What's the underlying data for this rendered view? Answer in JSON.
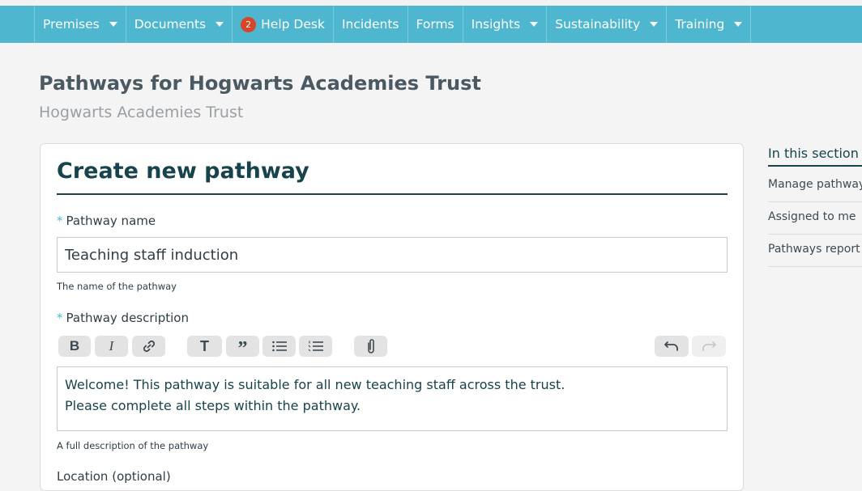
{
  "nav": {
    "items": [
      {
        "label": "Premises",
        "dropdown": true
      },
      {
        "label": "Documents",
        "dropdown": true
      },
      {
        "label": "Help Desk",
        "badge": "2",
        "dropdown": false
      },
      {
        "label": "Incidents",
        "dropdown": false
      },
      {
        "label": "Forms",
        "dropdown": false
      },
      {
        "label": "Insights",
        "dropdown": true
      },
      {
        "label": "Sustainability",
        "dropdown": true
      },
      {
        "label": "Training",
        "dropdown": true
      }
    ],
    "background": "#4eb7cf",
    "badge_color": "#d84526"
  },
  "page": {
    "title": "Pathways for Hogwarts Academies Trust",
    "subtitle": "Hogwarts Academies Trust"
  },
  "form": {
    "heading": "Create new pathway",
    "required_marker": "*",
    "name_label": "Pathway name",
    "name_value": "Teaching staff induction",
    "name_help": "The name of the pathway",
    "description_label": "Pathway description",
    "description_lines": [
      "Welcome! This pathway is suitable for all new teaching staff across the trust.",
      "Please complete all steps within the pathway."
    ],
    "description_help": "A full description of the pathway",
    "location_label": "Location (optional)",
    "toolbar": {
      "buttons": [
        "bold-icon",
        "italic-icon",
        "link-icon",
        "heading-icon",
        "quote-icon",
        "bullet-list-icon",
        "numbered-list-icon",
        "attachment-icon",
        "undo-icon",
        "redo-icon"
      ],
      "bold_glyph": "B",
      "italic_glyph": "I",
      "heading_glyph": "T",
      "quote_glyph": "”"
    }
  },
  "sidebar": {
    "title": "In this section",
    "items": [
      "Manage pathways",
      "Assigned to me",
      "Pathways report"
    ]
  },
  "colors": {
    "accent": "#4eb7cf",
    "heading": "#17434d"
  }
}
